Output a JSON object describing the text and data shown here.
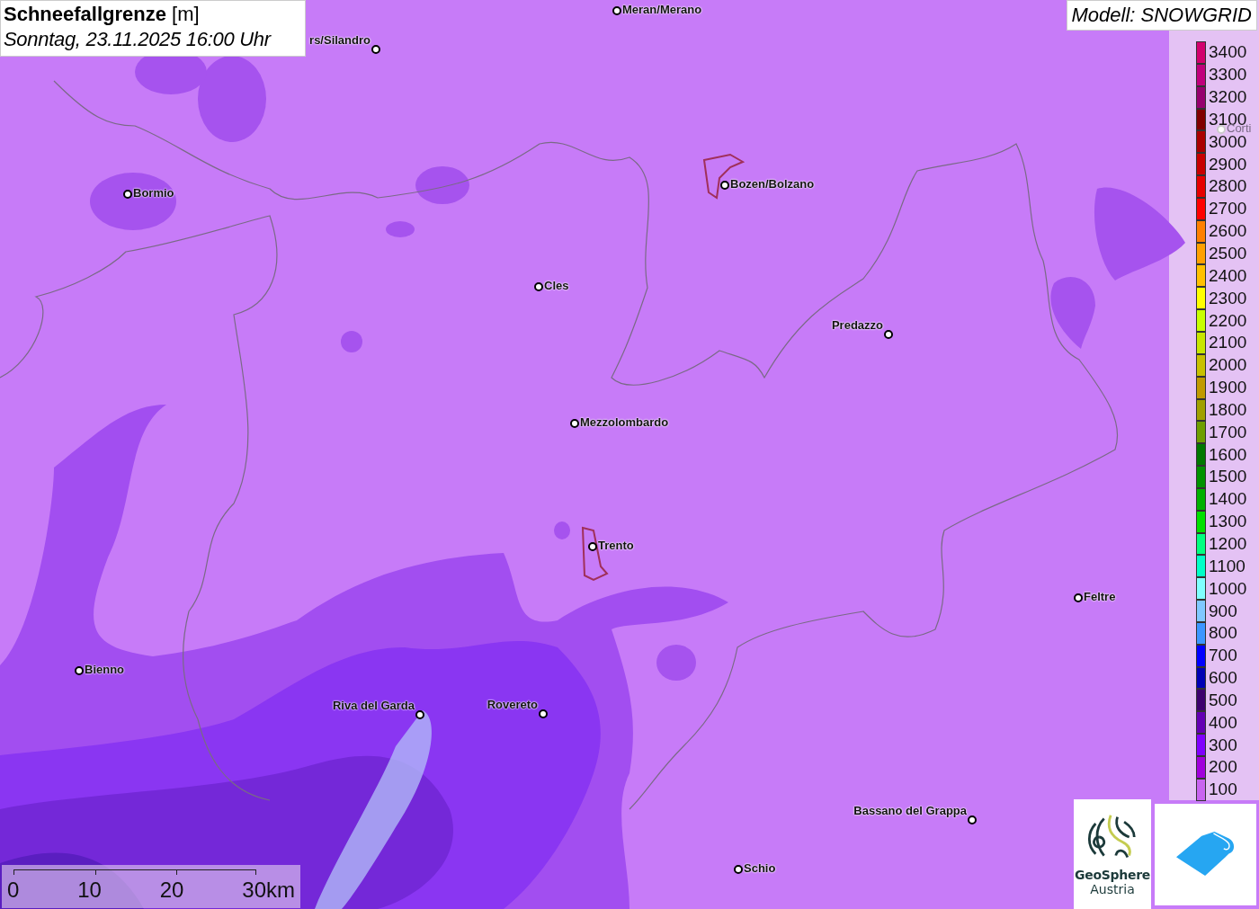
{
  "title": {
    "heading": "**Schneefallgrenze** [m]",
    "datetime": "Sonntag, 23.11.2025 16:00 Uhr"
  },
  "model_label": "Modell: SNOWGRID",
  "cities": [
    {
      "name": "Meran/Merano"
    },
    {
      "name": "rs/Silandro"
    },
    {
      "name": "Bormio"
    },
    {
      "name": "Bozen/Bolzano"
    },
    {
      "name": "Cles"
    },
    {
      "name": "Predazzo"
    },
    {
      "name": "Mezzolombardo"
    },
    {
      "name": "Trento"
    },
    {
      "name": "Feltre"
    },
    {
      "name": "Bienno"
    },
    {
      "name": "Riva del Garda"
    },
    {
      "name": "Rovereto"
    },
    {
      "name": "Bassano del Grappa"
    },
    {
      "name": "Schio"
    },
    {
      "name": "Corti"
    }
  ],
  "legend": [
    {
      "label": "3400",
      "color": "#d2006e"
    },
    {
      "label": "3300",
      "color": "#c0007c"
    },
    {
      "label": "3200",
      "color": "#96006e"
    },
    {
      "label": "3100",
      "color": "#800000"
    },
    {
      "label": "3000",
      "color": "#aa0000"
    },
    {
      "label": "2900",
      "color": "#c80000"
    },
    {
      "label": "2800",
      "color": "#e60000"
    },
    {
      "label": "2700",
      "color": "#ff0000"
    },
    {
      "label": "2600",
      "color": "#ff8000"
    },
    {
      "label": "2500",
      "color": "#ffa000"
    },
    {
      "label": "2400",
      "color": "#ffc000"
    },
    {
      "label": "2300",
      "color": "#ffff00"
    },
    {
      "label": "2200",
      "color": "#c8ff00"
    },
    {
      "label": "2100",
      "color": "#c8e600"
    },
    {
      "label": "2000",
      "color": "#c8c000"
    },
    {
      "label": "1900",
      "color": "#c09a00"
    },
    {
      "label": "1800",
      "color": "#a0a000"
    },
    {
      "label": "1700",
      "color": "#6e9e00"
    },
    {
      "label": "1600",
      "color": "#007800"
    },
    {
      "label": "1500",
      "color": "#009200"
    },
    {
      "label": "1400",
      "color": "#00b000"
    },
    {
      "label": "1300",
      "color": "#00e000"
    },
    {
      "label": "1200",
      "color": "#00ff80"
    },
    {
      "label": "1100",
      "color": "#00ffc8"
    },
    {
      "label": "1000",
      "color": "#80ffff"
    },
    {
      "label": "900",
      "color": "#80c8ff"
    },
    {
      "label": "800",
      "color": "#3c96ff"
    },
    {
      "label": "700",
      "color": "#0000ff"
    },
    {
      "label": "600",
      "color": "#0000b4"
    },
    {
      "label": "500",
      "color": "#3c006e"
    },
    {
      "label": "400",
      "color": "#6400b4"
    },
    {
      "label": "300",
      "color": "#8000ff"
    },
    {
      "label": "200",
      "color": "#a000dc"
    },
    {
      "label": "100",
      "color": "#c864f0"
    }
  ],
  "scale_bar": {
    "ticks": [
      "0",
      "10",
      "20",
      "30km"
    ]
  },
  "logo": {
    "name": "GeoSphere",
    "subtitle": "Austria"
  }
}
